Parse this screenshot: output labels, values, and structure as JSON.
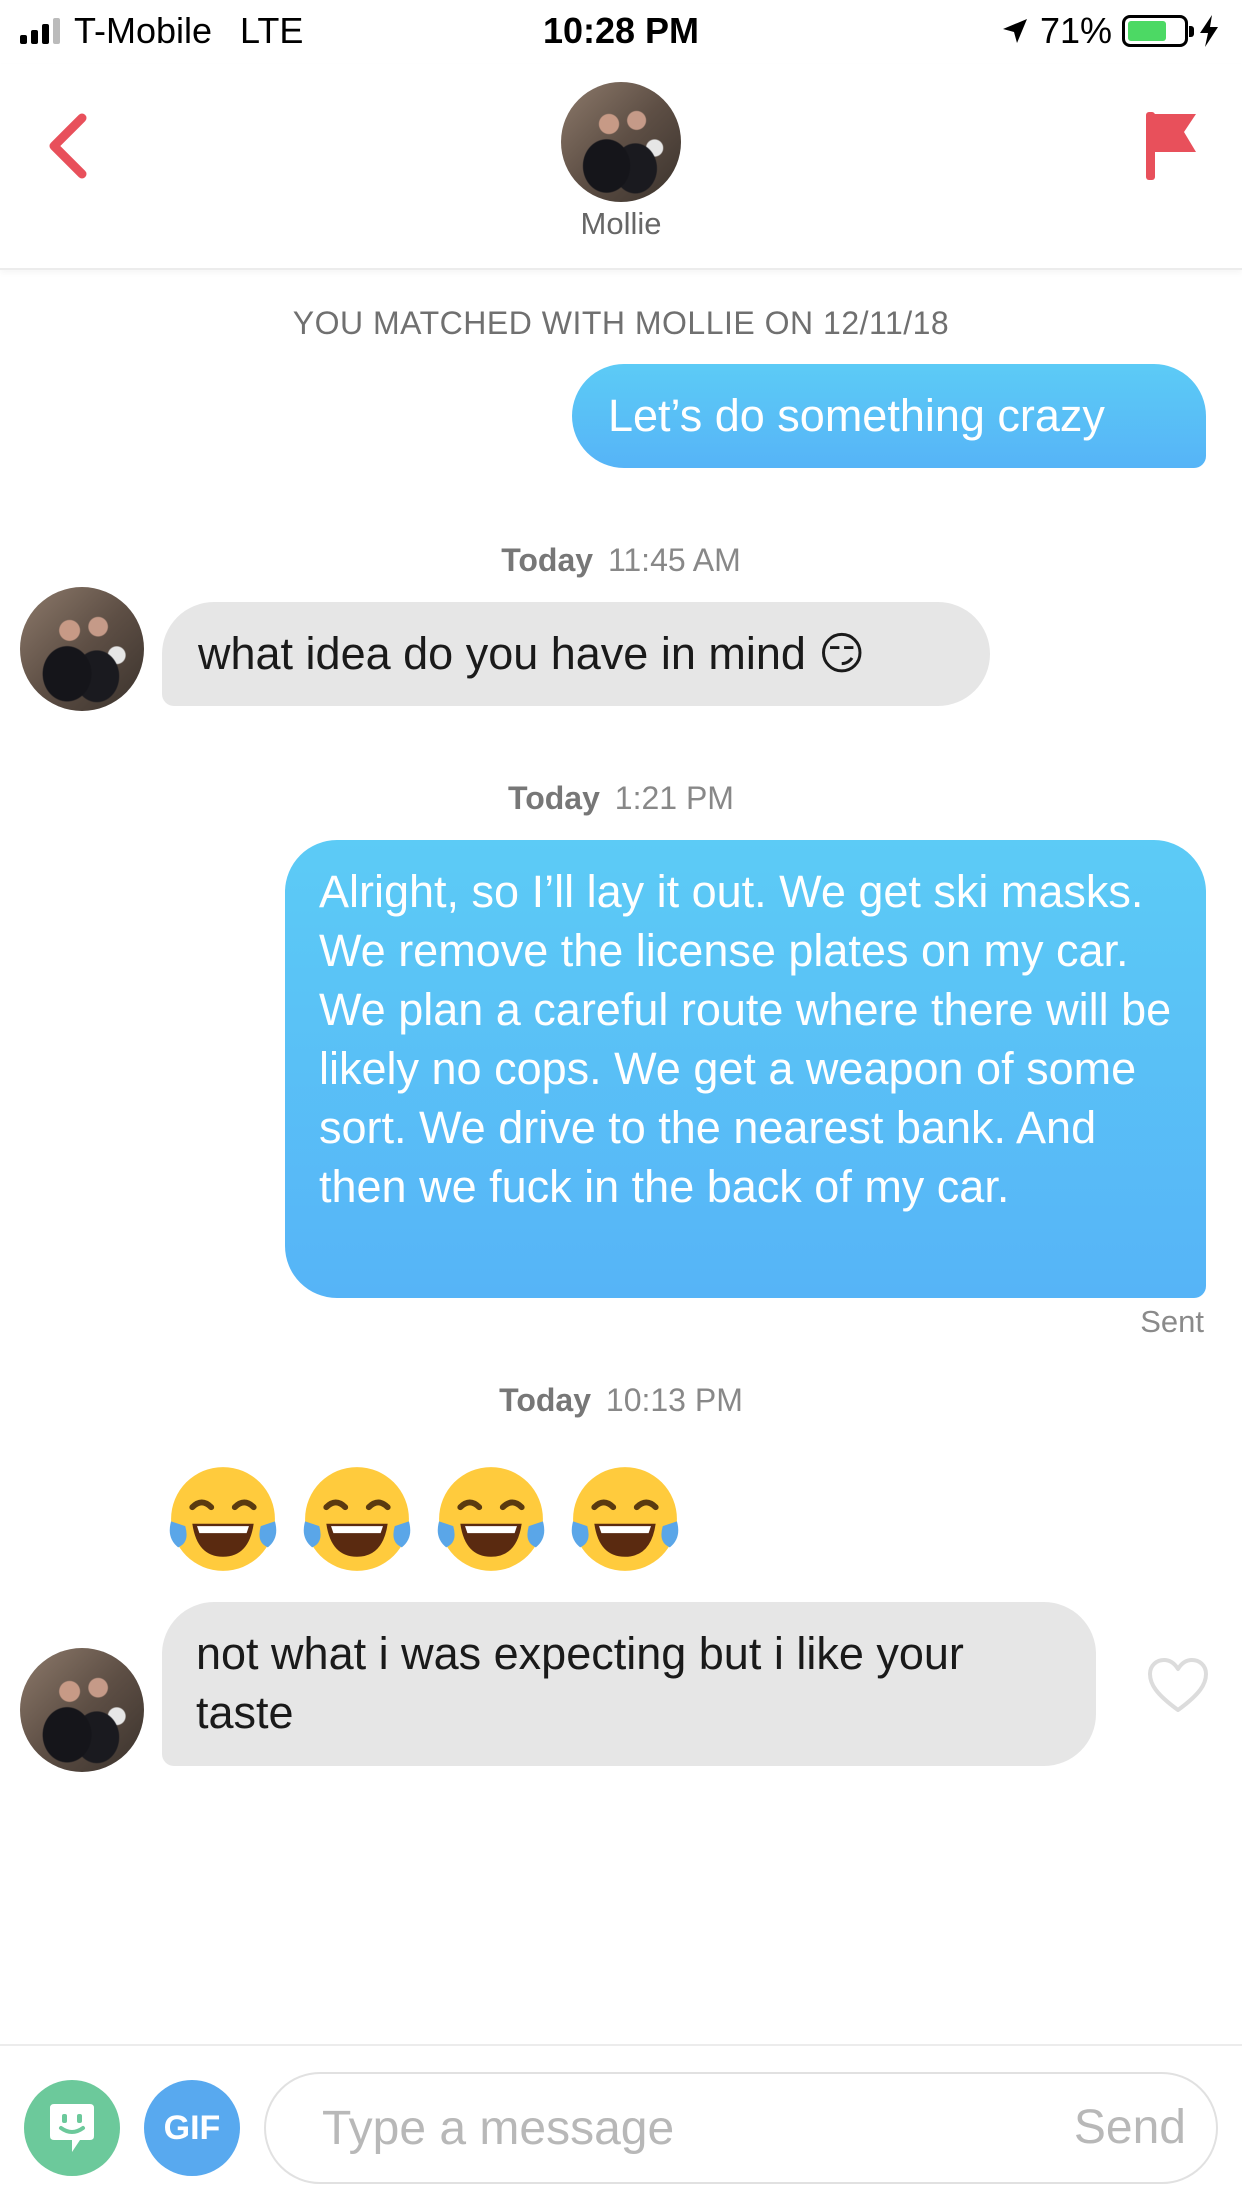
{
  "status_bar": {
    "carrier": "T-Mobile",
    "network": "LTE",
    "time": "10:28 PM",
    "battery": "71%",
    "battery_level": 0.71
  },
  "header": {
    "name": "Mollie",
    "back_icon": "chevron-left-icon",
    "flag_icon": "flag-icon"
  },
  "match_banner": "YOU MATCHED WITH MOLLIE ON 12/11/18",
  "messages": [
    {
      "text": "Let’s do something crazy"
    },
    {
      "day": "Today",
      "time": "11:45 AM",
      "text": "what idea do you have in mind 😏"
    },
    {
      "day": "Today",
      "time": "1:21 PM",
      "text": "Alright, so I’ll lay it out. We get ski masks. We remove the license plates on my car. We plan a careful route where there will be likely no cops. We get a weapon of some sort. We drive to the nearest bank. And then we fuck in the back of my car.",
      "status": "Sent"
    },
    {
      "day": "Today",
      "time": "10:13 PM",
      "emoji": "😂😂😂😂",
      "text": "not what i was expecting but i like your taste"
    }
  ],
  "composer": {
    "gif_label": "GIF",
    "placeholder": "Type a message",
    "send_label": "Send"
  },
  "colors": {
    "accent_red": "#e8505b",
    "sent_bubble": "#56b4f7",
    "received_bubble": "#e6e6e6",
    "sticker_green": "#6cc99b",
    "gif_blue": "#58a9ef"
  }
}
